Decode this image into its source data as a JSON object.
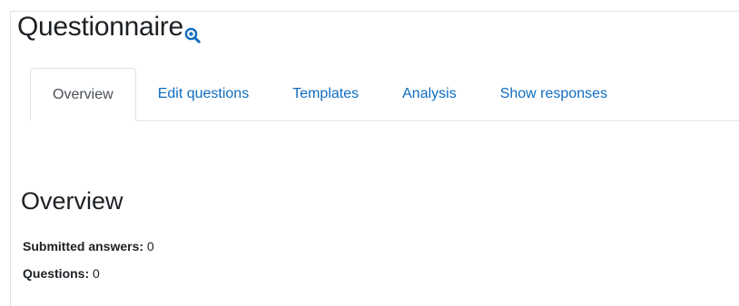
{
  "header": {
    "title": "Questionnaire",
    "help_icon": "search-plus-icon"
  },
  "tabs": [
    {
      "label": "Overview",
      "active": true
    },
    {
      "label": "Edit questions",
      "active": false
    },
    {
      "label": "Templates",
      "active": false
    },
    {
      "label": "Analysis",
      "active": false
    },
    {
      "label": "Show responses",
      "active": false
    }
  ],
  "overview": {
    "heading": "Overview",
    "submitted_label": "Submitted answers:",
    "submitted_value": "0",
    "questions_label": "Questions:",
    "questions_value": "0"
  },
  "colors": {
    "link": "#0f6cbf",
    "border": "#dee2e6",
    "text": "#1d2125"
  }
}
